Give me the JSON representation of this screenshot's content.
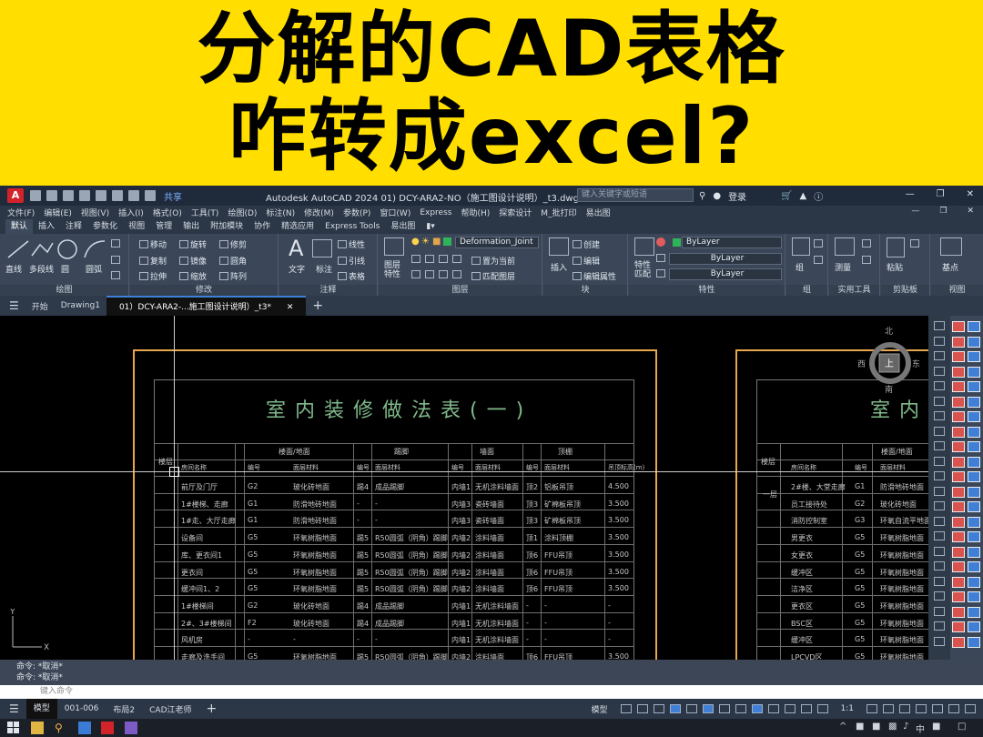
{
  "banner": {
    "line1": "分解的CAD表格",
    "line2": "咋转成excel?"
  },
  "titlebar": {
    "logo": "A",
    "share": "共享",
    "title": "Autodesk AutoCAD 2024    01) DCY-ARA2-NO（施工图设计说明）_t3.dwg",
    "search_placeholder": "键入关键字或短语",
    "login": "登录"
  },
  "menu": [
    "文件(F)",
    "编辑(E)",
    "视图(V)",
    "插入(I)",
    "格式(O)",
    "工具(T)",
    "绘图(D)",
    "标注(N)",
    "修改(M)",
    "参数(P)",
    "窗口(W)",
    "Express",
    "帮助(H)",
    "探索设计",
    "M_批打印",
    "易出图"
  ],
  "ribbon_tabs": [
    "默认",
    "插入",
    "注释",
    "参数化",
    "视图",
    "管理",
    "输出",
    "附加模块",
    "协作",
    "精选应用",
    "Express Tools",
    "易出图"
  ],
  "ribbon": {
    "draw": {
      "line": "直线",
      "polyline": "多段线",
      "circle": "圆",
      "arc": "圆弧",
      "label": "绘图"
    },
    "modify": {
      "move": "移动",
      "rotate": "旋转",
      "trim": "修剪",
      "copy": "复制",
      "mirror": "镜像",
      "fillet": "圆角",
      "stretch": "拉伸",
      "scale": "缩放",
      "array": "阵列",
      "label": "修改"
    },
    "annotation": {
      "text": "文字",
      "dim": "标注",
      "linear": "线性",
      "leader": "引线",
      "table": "表格",
      "label": "注释"
    },
    "layers": {
      "layer_props": "图层特性",
      "current_layer": "Deformation_Joint",
      "make_current": "置为当前",
      "match": "匹配图层",
      "label": "图层"
    },
    "block": {
      "insert": "插入",
      "create": "创建",
      "edit": "编辑",
      "edit_attr": "编辑属性",
      "label": "块"
    },
    "properties": {
      "match": "特性匹配",
      "bylayer_color": "ByLayer",
      "bylayer_linetype": "ByLayer",
      "bylayer_lineweight": "ByLayer",
      "label": "特性"
    },
    "groups": {
      "group": "组",
      "label": "组"
    },
    "utilities": {
      "measure": "测量",
      "label": "实用工具"
    },
    "clipboard": {
      "paste": "粘贴",
      "label": "剪贴板"
    },
    "view": {
      "base": "基点",
      "label": "视图"
    }
  },
  "doc_tabs": [
    "开始",
    "Drawing1",
    "01）DCY-ARA2-...施工图设计说明）_t3*"
  ],
  "drawing": {
    "title_left": "室内装修做法表(一)",
    "title_right": "室内",
    "side_label_left": "楼层",
    "side_label_right": "楼层",
    "group_headers_left": [
      "楼面/地面",
      "踢脚",
      "墙面",
      "顶棚"
    ],
    "col_headers_left": [
      "房间名称",
      "编号",
      "面层材料",
      "编号",
      "面层材料",
      "编号",
      "面层材料",
      "编号",
      "面层材料",
      "吊顶标高(m)"
    ],
    "rows_left": [
      [
        "前厅及门厅",
        "G2",
        "玻化砖地面",
        "踢4",
        "成品踢脚",
        "内墙1",
        "无机涂料墙面",
        "顶2",
        "铝板吊顶",
        "4.500"
      ],
      [
        "1#楼梯、走廊",
        "G1",
        "防滑地砖地面",
        "-",
        "-",
        "内墙3",
        "瓷砖墙面",
        "顶3",
        "矿棉板吊顶",
        "3.500"
      ],
      [
        "1#走、大厅走廊",
        "G1",
        "防滑地砖地面",
        "-",
        "-",
        "内墙3",
        "瓷砖墙面",
        "顶3",
        "矿棉板吊顶",
        "3.500"
      ],
      [
        "设备间",
        "G5",
        "环氧树脂地面",
        "踢5",
        "R50圆弧（阴角）踢脚",
        "内墙2",
        "涂料墙面",
        "顶1",
        "涂料顶棚",
        "3.500"
      ],
      [
        "库、更衣间1",
        "G5",
        "环氧树脂地面",
        "踢5",
        "R50圆弧（阴角）踢脚",
        "内墙2",
        "涂料墙面",
        "顶6",
        "FFU吊顶",
        "3.500"
      ],
      [
        "更衣间",
        "G5",
        "环氧树脂地面",
        "踢5",
        "R50圆弧（阴角）踢脚",
        "内墙2",
        "涂料墙面",
        "顶6",
        "FFU吊顶",
        "3.500"
      ],
      [
        "缓冲间1、2",
        "G5",
        "环氧树脂地面",
        "踢5",
        "R50圆弧（阴角）踢脚",
        "内墙2",
        "涂料墙面",
        "顶6",
        "FFU吊顶",
        "3.500"
      ],
      [
        "1#楼梯间",
        "G2",
        "玻化砖地面",
        "踢4",
        "成品踢脚",
        "内墙1",
        "无机涂料墙面",
        "-",
        "-",
        "-"
      ],
      [
        "2#、3#楼梯间",
        "F2",
        "玻化砖地面",
        "踢4",
        "成品踢脚",
        "内墙1",
        "无机涂料墙面",
        "-",
        "-",
        "-"
      ],
      [
        "风机房",
        "-",
        "-",
        "-",
        "-",
        "内墙1",
        "无机涂料墙面",
        "-",
        "-",
        "-"
      ],
      [
        "走廊及洗手间",
        "G5",
        "环氧树脂地面",
        "踢5",
        "R50圆弧（阴角）踢脚",
        "内墙2",
        "涂料墙面",
        "顶6",
        "FFU吊顶",
        "3.500"
      ]
    ],
    "group_headers_right": [
      "楼面/地面"
    ],
    "col_headers_right": [
      "房间名称",
      "编号",
      "面层材料"
    ],
    "first_floor_label": "一层",
    "rows_right": [
      [
        "2#楼、大堂走廊",
        "G1",
        "防滑地砖地面"
      ],
      [
        "员工接待处",
        "G2",
        "玻化砖地面"
      ],
      [
        "消防控制室",
        "G3",
        "环氧自流平地面"
      ],
      [
        "男更衣",
        "G5",
        "环氧树脂地面"
      ],
      [
        "女更衣",
        "G5",
        "环氧树脂地面"
      ],
      [
        "缓冲区",
        "G5",
        "环氧树脂地面"
      ],
      [
        "洁净区",
        "G5",
        "环氧树脂地面"
      ],
      [
        "更衣区",
        "G5",
        "环氧树脂地面"
      ],
      [
        "BSC区",
        "G5",
        "环氧树脂地面"
      ],
      [
        "缓冲区",
        "G5",
        "环氧树脂地面"
      ],
      [
        "LPCVD区",
        "G5",
        "环氧树脂地面"
      ]
    ]
  },
  "compass": {
    "north": "北",
    "south": "南",
    "east": "东",
    "west": "西",
    "top": "上"
  },
  "command": {
    "line1": "命令: *取消*",
    "line2": "命令: *取消*",
    "placeholder": "键入命令"
  },
  "layout_tabs": [
    "模型",
    "001-006",
    "布局2",
    "CAD江老师"
  ],
  "status": {
    "model": "模型",
    "scale": "1:1"
  },
  "taskbar": {
    "ime": "中"
  }
}
